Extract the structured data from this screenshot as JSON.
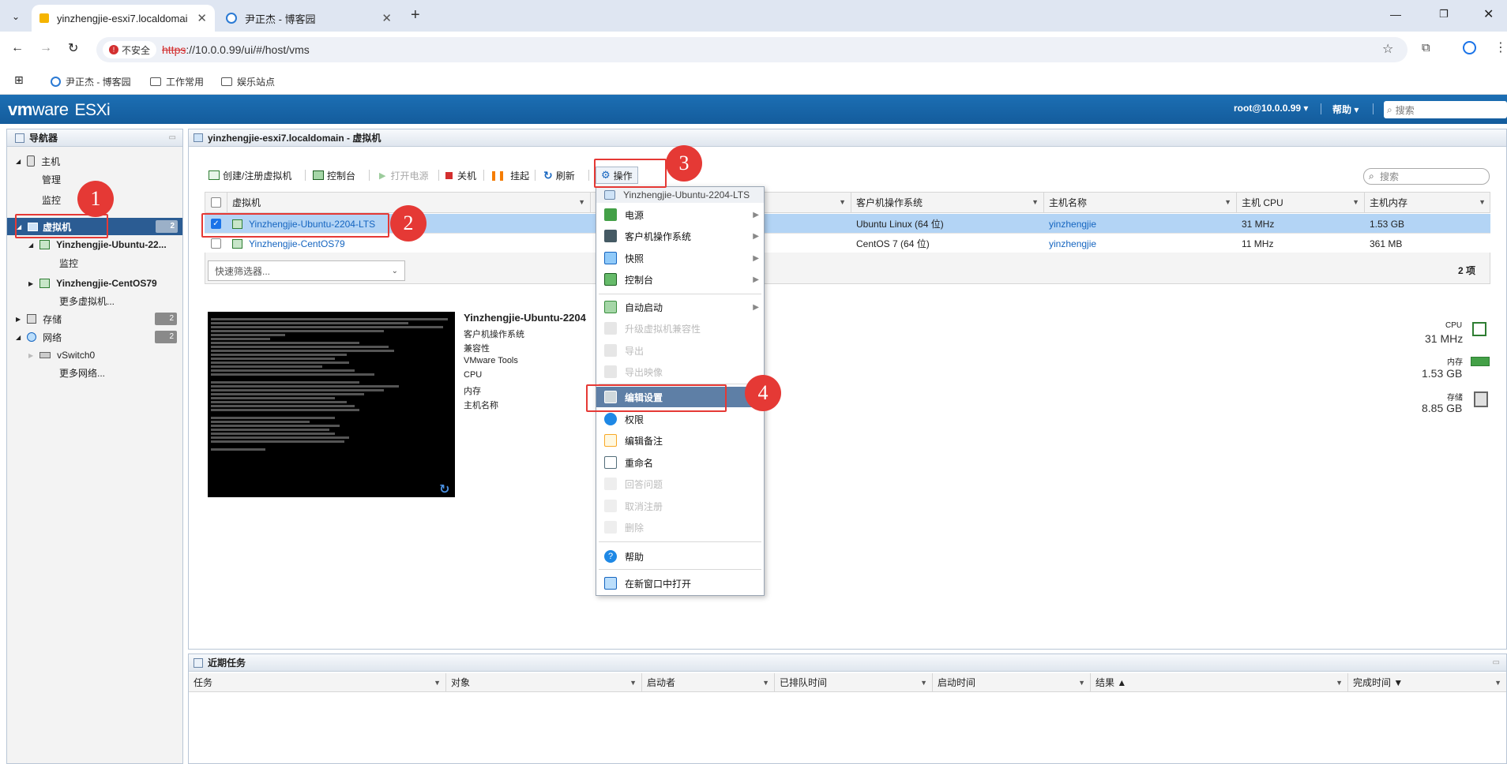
{
  "browser": {
    "tabs": [
      {
        "title": "yinzhengjie-esxi7.localdomai",
        "active": true
      },
      {
        "title": "尹正杰 - 博客园",
        "active": false
      }
    ],
    "new_tab": "+",
    "security_label": "不安全",
    "url_scheme": "https",
    "url_rest": "://10.0.0.99/ui/#/host/vms",
    "bookmarks": [
      "尹正杰 - 博客园",
      "工作常用",
      "娱乐站点"
    ]
  },
  "esxi_header": {
    "logo_vm": "vm",
    "logo_ware": "ware",
    "logo_esxi": "ESXi",
    "user": "root@10.0.0.99 ▾",
    "help": "帮助 ▾",
    "search_placeholder": "搜索"
  },
  "navigator": {
    "title": "导航器",
    "host": "主机",
    "manage": "管理",
    "monitor": "监控",
    "vms": "虚拟机",
    "vms_count": "2",
    "vm1": "Yinzhengjie-Ubuntu-22...",
    "vm1_monitor": "监控",
    "vm2": "Yinzhengjie-CentOS79",
    "more_vms": "更多虚拟机...",
    "storage": "存储",
    "storage_count": "2",
    "network": "网络",
    "network_count": "2",
    "vswitch": "vSwitch0",
    "more_networks": "更多网络..."
  },
  "main": {
    "title": "yinzhengjie-esxi7.localdomain - 虚拟机",
    "toolbar": {
      "create": "创建/注册虚拟机",
      "console": "控制台",
      "power_on": "打开电源",
      "shutdown": "关机",
      "suspend": "挂起",
      "refresh": "刷新",
      "actions": "操作"
    },
    "search_placeholder": "搜索",
    "columns": [
      "虚拟机",
      "客户机操作系统",
      "主机名称",
      "主机 CPU",
      "主机内存"
    ],
    "rows": [
      {
        "name": "Yinzhengjie-Ubuntu-2204-LTS",
        "os": "Ubuntu Linux (64 位)",
        "host": "yinzhengjie",
        "cpu": "31 MHz",
        "mem": "1.53 GB",
        "checked": true
      },
      {
        "name": "Yinzhengjie-CentOS79",
        "os": "CentOS 7 (64 位)",
        "host": "yinzhengjie",
        "cpu": "11 MHz",
        "mem": "361 MB",
        "checked": false
      }
    ],
    "quick_filter": "快速筛选器...",
    "item_count": "2 项"
  },
  "detail": {
    "vm_name": "Yinzhengjie-Ubuntu-2204",
    "labels": [
      "客户机操作系统",
      "兼容性",
      "VMware Tools",
      "CPU",
      "内存",
      "主机名称"
    ],
    "cpu_label": "CPU",
    "cpu_value": "31 MHz",
    "mem_label": "内存",
    "mem_value": "1.53 GB",
    "storage_label": "存储",
    "storage_value": "8.85 GB"
  },
  "menu": {
    "header": "Yinzhengjie-Ubuntu-2204-LTS",
    "items": [
      {
        "label": "电源",
        "submenu": true,
        "enabled": true
      },
      {
        "label": "客户机操作系统",
        "submenu": true,
        "enabled": true
      },
      {
        "label": "快照",
        "submenu": true,
        "enabled": true
      },
      {
        "label": "控制台",
        "submenu": true,
        "enabled": true
      },
      {
        "label": "自动启动",
        "submenu": true,
        "enabled": true
      },
      {
        "label": "升级虚拟机兼容性",
        "submenu": false,
        "enabled": false
      },
      {
        "label": "导出",
        "submenu": false,
        "enabled": false
      },
      {
        "label": "导出映像",
        "submenu": false,
        "enabled": false
      },
      {
        "label": "编辑设置",
        "submenu": false,
        "enabled": true
      },
      {
        "label": "权限",
        "submenu": false,
        "enabled": true
      },
      {
        "label": "编辑备注",
        "submenu": false,
        "enabled": true
      },
      {
        "label": "重命名",
        "submenu": false,
        "enabled": true
      },
      {
        "label": "回答问题",
        "submenu": false,
        "enabled": false
      },
      {
        "label": "取消注册",
        "submenu": false,
        "enabled": false
      },
      {
        "label": "删除",
        "submenu": false,
        "enabled": false
      },
      {
        "label": "帮助",
        "submenu": false,
        "enabled": true
      },
      {
        "label": "在新窗口中打开",
        "submenu": false,
        "enabled": true
      }
    ]
  },
  "annotations": [
    "1",
    "2",
    "3",
    "4"
  ],
  "tasks": {
    "title": "近期任务",
    "columns": [
      "任务",
      "对象",
      "启动者",
      "已排队时间",
      "启动时间",
      "结果 ▲",
      "完成时间 ▼"
    ]
  },
  "colors": {
    "accent": "#1565c0",
    "header": "#1c6fb4",
    "selected": "#2b5c93",
    "annotation": "#e53935"
  }
}
